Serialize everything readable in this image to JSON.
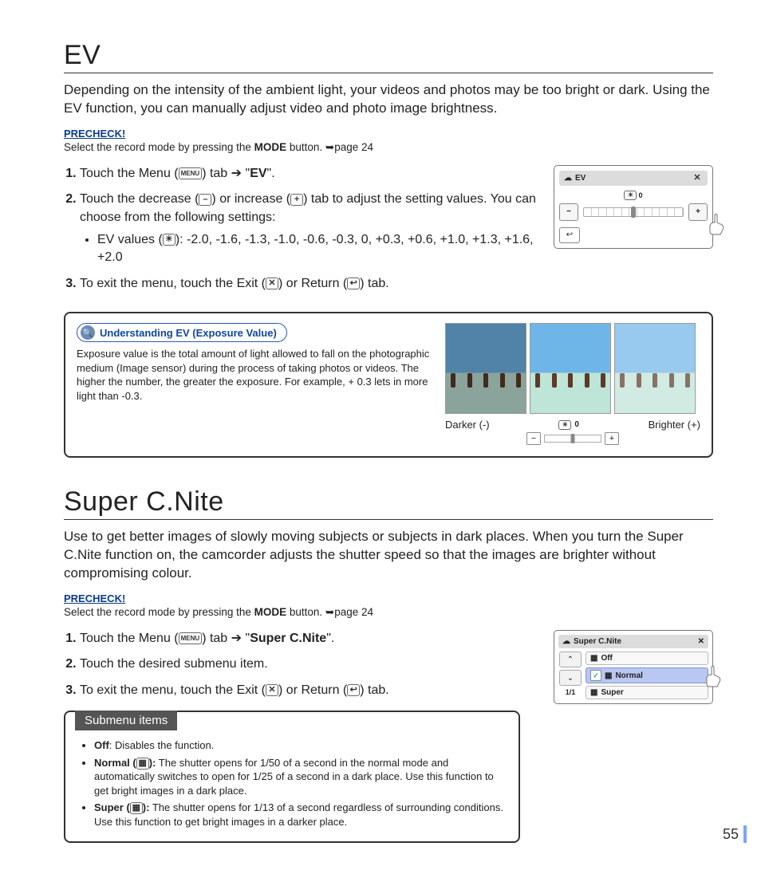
{
  "ev": {
    "heading": "EV",
    "intro": "Depending on the intensity of the ambient light, your videos and photos may be too bright or dark. Using the EV function, you can manually adjust video and photo image brightness.",
    "precheck_label": "PRECHECK!",
    "precheck_pre": "Select the record mode by pressing the ",
    "precheck_bold": "MODE",
    "precheck_post": " button. ➥page 24",
    "step1_pre": "Touch the Menu (",
    "menu_icon": "MENU",
    "step1_mid": ") tab ➔ \"",
    "step1_bold": "EV",
    "step1_post": "\".",
    "step2_pre": "Touch the decrease (",
    "minus_icon": "–",
    "step2_mid": ") or increase (",
    "plus_icon": "+",
    "step2_post": ") tab to adjust the setting values. You can choose from the following settings:",
    "sub_pre": "EV values (",
    "ev_icon": "☀",
    "sub_post": "): -2.0, -1.6, -1.3, -1.0, -0.6, -0.3, 0, +0.3, +0.6, +1.0, +1.3, +1.6, +2.0",
    "step3_pre": "To exit the menu, touch the Exit (",
    "exit_icon": "✕",
    "step3_mid": ") or Return (",
    "return_icon": "↩",
    "step3_post": ") tab.",
    "screen": {
      "title": "EV",
      "value_label": "0",
      "minus": "−",
      "plus": "+",
      "return": "↩",
      "close": "✕"
    },
    "panel": {
      "pill": "Understanding EV (Exposure Value)",
      "text": "Exposure value is the total amount of light allowed to fall on the photographic medium (Image sensor) during the process of taking photos or videos. The higher the number, the greater the exposure. For example, + 0.3 lets in more light than -0.3.",
      "darker": "Darker (-)",
      "brighter": "Brighter (+)",
      "slider_label": "0"
    }
  },
  "cnite": {
    "heading": "Super C.Nite",
    "intro": "Use to get better images of slowly moving subjects or subjects in dark places. When you turn the Super C.Nite function on, the camcorder adjusts the shutter speed so that the images are brighter without compromising colour.",
    "precheck_label": "PRECHECK!",
    "precheck_pre": "Select the record mode by pressing the ",
    "precheck_bold": "MODE",
    "precheck_post": " button. ➥page 24",
    "step1_pre": "Touch the Menu (",
    "menu_icon": "MENU",
    "step1_mid": ") tab ➔ \"",
    "step1_bold": "Super C.Nite",
    "step1_post": "\".",
    "step2": "Touch the desired submenu item.",
    "step3_pre": "To exit the menu, touch the Exit (",
    "exit_icon": "✕",
    "step3_mid": ") or Return (",
    "return_icon": "↩",
    "step3_post": ") tab.",
    "screen": {
      "title": "Super C.Nite",
      "close": "✕",
      "up": "⌃",
      "down": "⌄",
      "page": "1/1",
      "row_off": "Off",
      "row_normal": "Normal",
      "row_super": "Super",
      "check": "✓"
    },
    "submenu": {
      "tab": "Submenu items",
      "off_b": "Off",
      "off_t": ": Disables the function.",
      "normal_b": "Normal (",
      "normal_b2": "):",
      "normal_t": " The shutter opens for 1/50 of a second in the normal mode and automatically switches to open for 1/25 of a second in a dark place. Use this function to get bright images in a dark place.",
      "super_b": "Super (",
      "super_b2": "):",
      "super_t": " The shutter opens for 1/13 of a second regardless of surrounding conditions. Use this function to get bright images in a darker place."
    }
  },
  "page_number": "55"
}
